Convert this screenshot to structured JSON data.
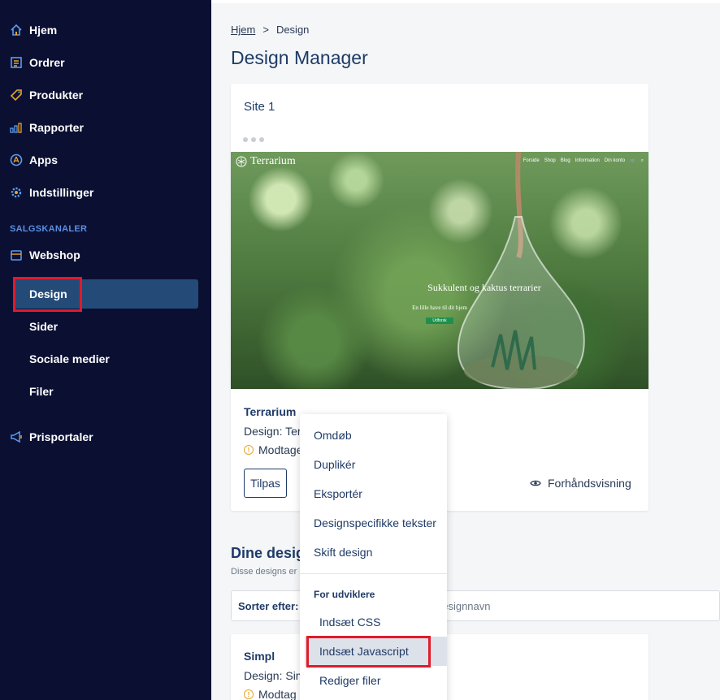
{
  "sidebar": {
    "nav": [
      {
        "label": "Hjem",
        "icon": "home-icon"
      },
      {
        "label": "Ordrer",
        "icon": "orders-icon"
      },
      {
        "label": "Produkter",
        "icon": "tag-icon"
      },
      {
        "label": "Rapporter",
        "icon": "chart-icon"
      },
      {
        "label": "Apps",
        "icon": "apps-icon"
      },
      {
        "label": "Indstillinger",
        "icon": "gear-icon"
      }
    ],
    "section_label": "SALGSKANALER",
    "webshop": {
      "label": "Webshop",
      "icon": "store-icon"
    },
    "sub_items": [
      "Design",
      "Sider",
      "Sociale medier",
      "Filer"
    ],
    "active_sub": "Design",
    "prisportaler": {
      "label": "Prisportaler",
      "icon": "megaphone-icon"
    }
  },
  "breadcrumb": {
    "home": "Hjem",
    "separator": ">",
    "current": "Design"
  },
  "page_title": "Design Manager",
  "site_card": {
    "title": "Site 1",
    "preview": {
      "logo": "Terrarium",
      "nav": [
        "Forside",
        "Shop",
        "Blog",
        "Information",
        "Din konto"
      ],
      "hero_title": "Sukkulent og kaktus terrarier",
      "hero_sub": "En lille have til dit hjem",
      "hero_button": "Udforsk"
    },
    "name": "Terrarium",
    "design_line": "Design: Ter",
    "status": "Modtage",
    "customize_button": "Tilpas",
    "preview_link": "Forhåndsvisning"
  },
  "designs_section": {
    "title": "Dine desig",
    "desc": "Disse designs er",
    "sort_label": "Sorter efter:",
    "sort_value": "designnavn"
  },
  "second_card": {
    "name": "Simpl",
    "design_line": "Design: Sim",
    "status": "Modtag"
  },
  "menu": {
    "items": [
      "Omdøb",
      "Duplikér",
      "Eksportér",
      "Designspecifikke tekster",
      "Skift design"
    ],
    "dev_heading": "For udviklere",
    "dev_items": [
      "Indsæt CSS",
      "Indsæt Javascript",
      "Rediger filer"
    ],
    "active_item": "Indsæt Javascript"
  },
  "colors": {
    "sidebar_bg": "#0b1033",
    "active_bg": "#244a78",
    "highlight_red": "#e01b2b",
    "accent_blue": "#1f3a66",
    "warn": "#e8a42a"
  }
}
